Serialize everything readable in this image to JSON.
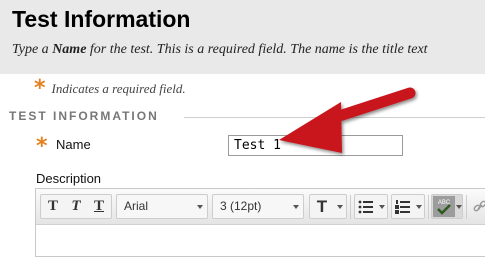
{
  "header": {
    "title": "Test Information",
    "instructions_pre": "Type a ",
    "instructions_bold": "Name",
    "instructions_post": " for the test. This is a required field. The name is the title text"
  },
  "required_legend": {
    "marker": "*",
    "text": "Indicates a required field."
  },
  "section": {
    "heading": "TEST INFORMATION"
  },
  "name_field": {
    "marker": "*",
    "label": "Name",
    "value": "Test 1"
  },
  "description": {
    "label": "Description",
    "toolbar": {
      "bold_label": "T",
      "italic_label": "T",
      "underline_label": "T",
      "font_family": "Arial",
      "font_size": "3 (12pt)",
      "text_color_label": "T",
      "spellcheck_label": "ABC"
    }
  },
  "colors": {
    "header_bg": "#e9e9e9",
    "required_marker": "#e5801f",
    "annotation_arrow": "#c8141b"
  },
  "icons": [
    "bold-icon",
    "italic-icon",
    "underline-icon",
    "text-color-icon",
    "bullet-list-icon",
    "numbered-list-icon",
    "spellcheck-icon",
    "link-icon"
  ]
}
